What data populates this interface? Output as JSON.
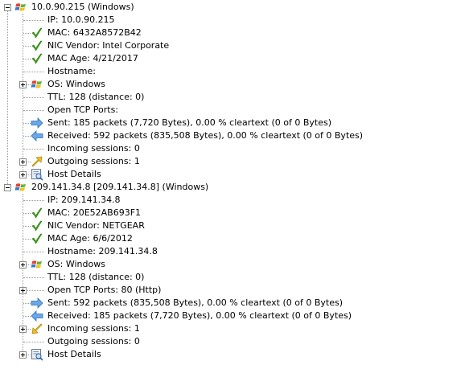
{
  "hosts": [
    {
      "title": "10.0.90.215 (Windows)",
      "icon": "windows-logo-icon",
      "expanded": true,
      "children": [
        {
          "label": "IP: 10.0.90.215",
          "icon": null,
          "expander": null
        },
        {
          "label": "MAC: 6432A8572B42",
          "icon": "green-check-icon",
          "expander": null
        },
        {
          "label": "NIC Vendor: Intel Corporate",
          "icon": "green-check-icon",
          "expander": null
        },
        {
          "label": "MAC Age: 4/21/2017",
          "icon": "green-check-icon",
          "expander": null
        },
        {
          "label": "Hostname:",
          "icon": null,
          "expander": null
        },
        {
          "label": "OS: Windows",
          "icon": "windows-logo-icon",
          "expander": "plus"
        },
        {
          "label": "TTL: 128 (distance: 0)",
          "icon": null,
          "expander": null
        },
        {
          "label": "Open TCP Ports:",
          "icon": null,
          "expander": null
        },
        {
          "label": "Sent: 185 packets (7,720 Bytes), 0.00 % cleartext (0 of 0 Bytes)",
          "icon": "arrow-right-icon",
          "expander": null
        },
        {
          "label": "Received: 592 packets (835,508 Bytes), 0.00 % cleartext (0 of 0 Bytes)",
          "icon": "arrow-left-icon",
          "expander": null
        },
        {
          "label": "Incoming sessions: 0",
          "icon": null,
          "expander": null
        },
        {
          "label": "Outgoing sessions: 1",
          "icon": "outgoing-arrow-icon",
          "expander": "plus"
        },
        {
          "label": "Host Details",
          "icon": "host-details-icon",
          "expander": "plus"
        }
      ]
    },
    {
      "title": "209.141.34.8 [209.141.34.8] (Windows)",
      "icon": "windows-logo-icon",
      "expanded": true,
      "children": [
        {
          "label": "IP: 209.141.34.8",
          "icon": null,
          "expander": null
        },
        {
          "label": "MAC: 20E52AB693F1",
          "icon": "green-check-icon",
          "expander": null
        },
        {
          "label": "NIC Vendor: NETGEAR",
          "icon": "green-check-icon",
          "expander": null
        },
        {
          "label": "MAC Age: 6/6/2012",
          "icon": "green-check-icon",
          "expander": null
        },
        {
          "label": "Hostname: 209.141.34.8",
          "icon": null,
          "expander": null
        },
        {
          "label": "OS: Windows",
          "icon": "windows-logo-icon",
          "expander": "plus"
        },
        {
          "label": "TTL: 128 (distance: 0)",
          "icon": null,
          "expander": null
        },
        {
          "label": "Open TCP Ports: 80 (Http)",
          "icon": null,
          "expander": "plus"
        },
        {
          "label": "Sent: 592 packets (835,508 Bytes), 0.00 % cleartext (0 of 0 Bytes)",
          "icon": "arrow-right-icon",
          "expander": null
        },
        {
          "label": "Received: 185 packets (7,720 Bytes), 0.00 % cleartext (0 of 0 Bytes)",
          "icon": "arrow-left-icon",
          "expander": null
        },
        {
          "label": "Incoming sessions: 1",
          "icon": "incoming-arrow-icon",
          "expander": "plus"
        },
        {
          "label": "Outgoing sessions: 0",
          "icon": null,
          "expander": null
        },
        {
          "label": "Host Details",
          "icon": "host-details-icon",
          "expander": "plus"
        }
      ]
    }
  ],
  "colors": {
    "check_green": "#3fa51b",
    "arrow_blue": "#4a8fd8",
    "arrow_yellow": "#f2c21b",
    "tree_line": "#9a9a9a"
  }
}
